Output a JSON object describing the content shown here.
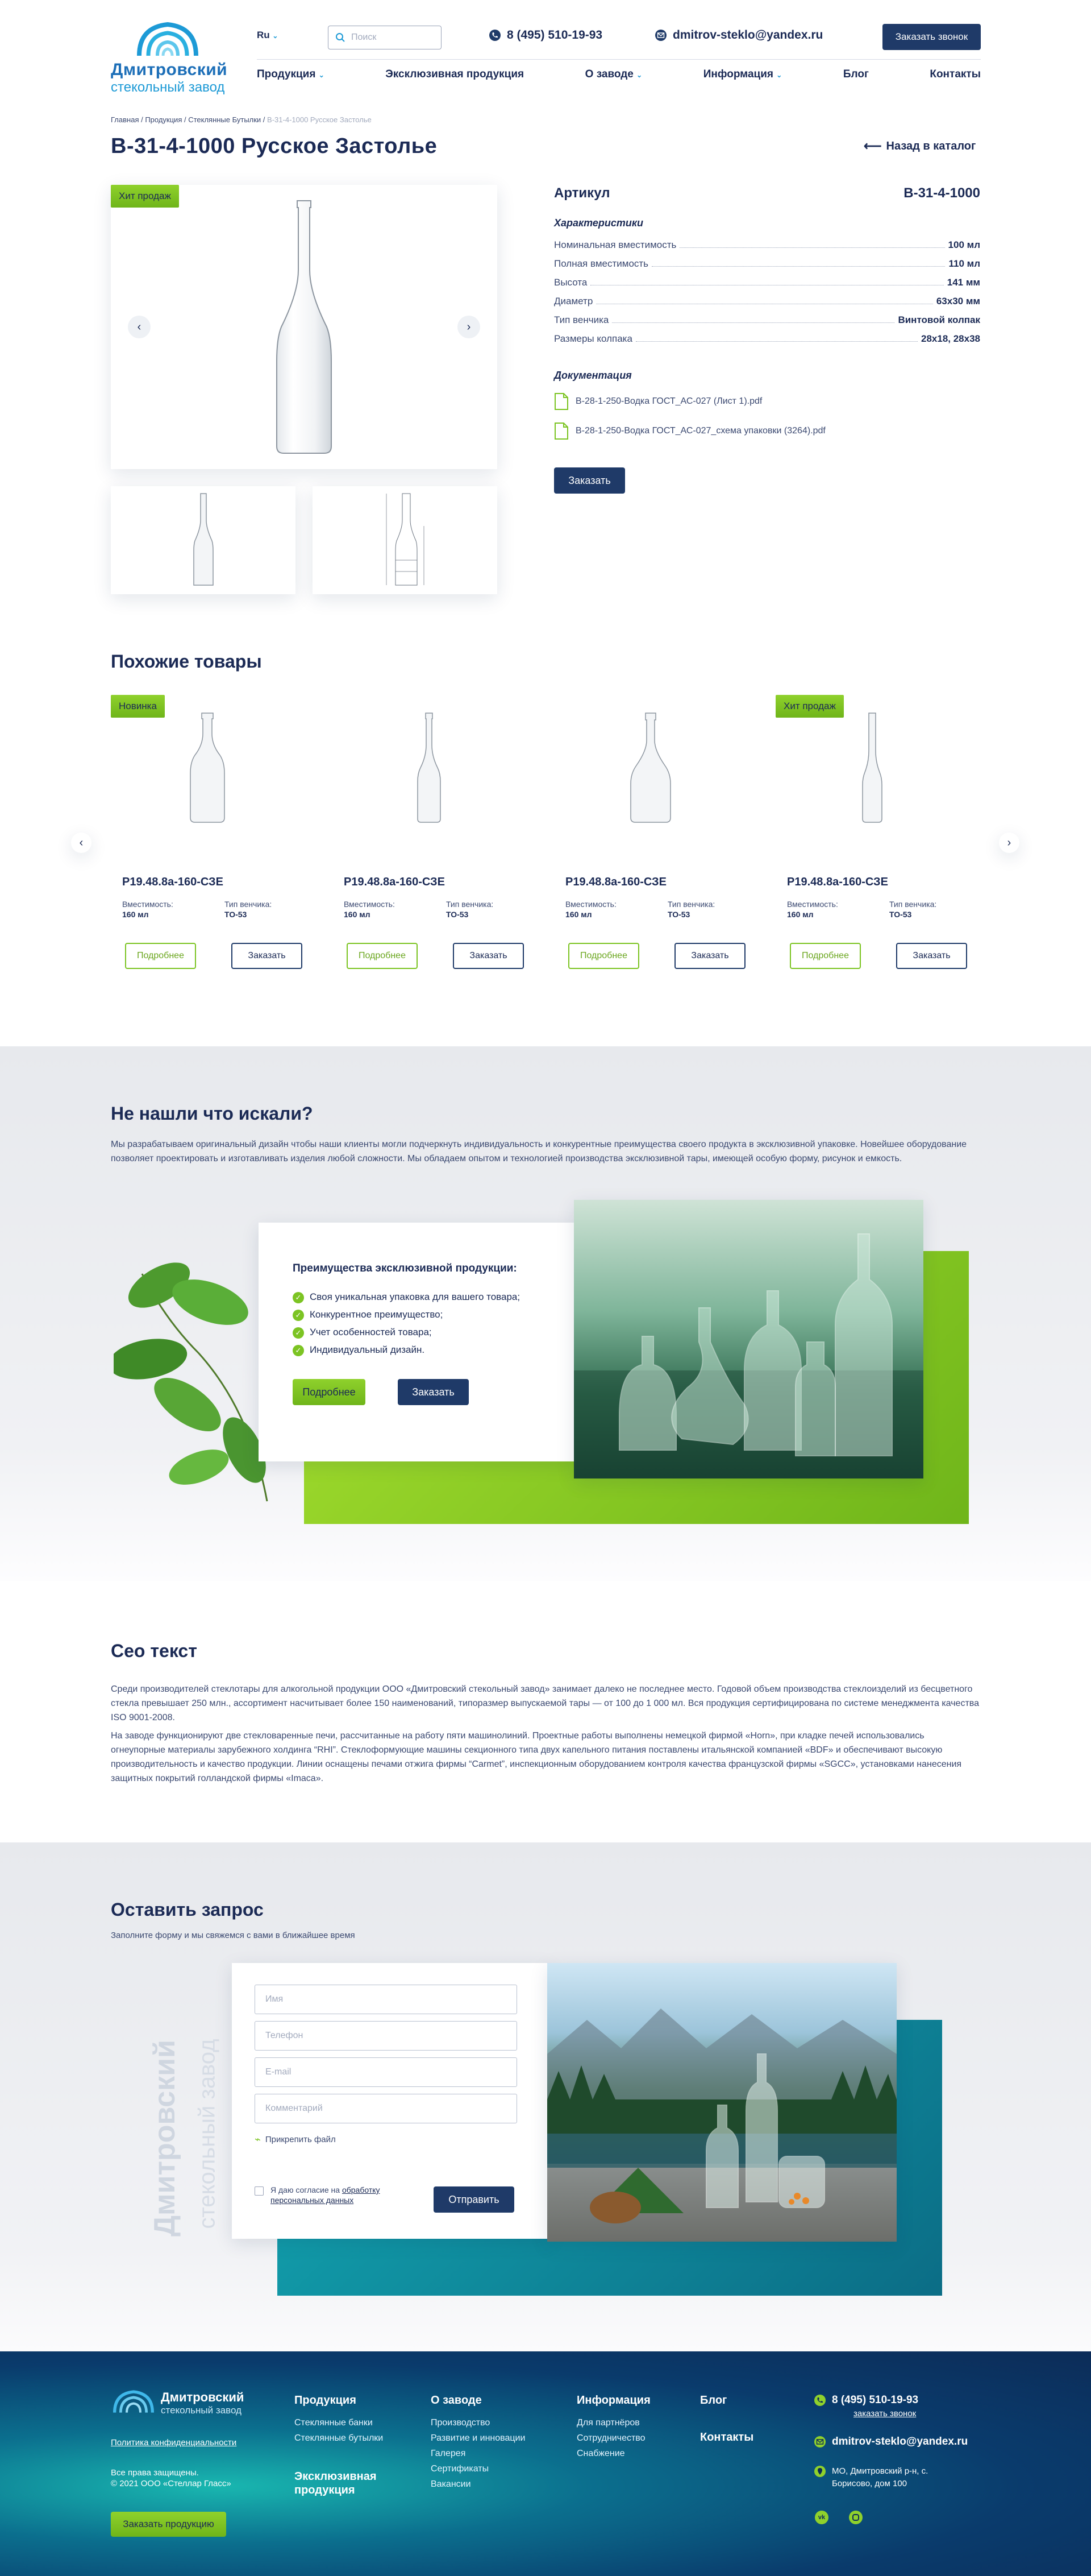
{
  "header": {
    "logo_top": "Дмитровский",
    "logo_bottom": "стекольный завод",
    "lang": "Ru",
    "search_placeholder": "Поиск",
    "phone": "8 (495) 510-19-93",
    "email": "dmitrov-steklo@yandex.ru",
    "callback_label": "Заказать звонок",
    "nav": [
      "Продукция",
      "Эксклюзивная продукция",
      "О заводе",
      "Информация",
      "Блог",
      "Контакты"
    ]
  },
  "breadcrumb": {
    "path": "Главная / Продукция / Стеклянные Бутылки /",
    "current": "В-31-4-1000 Русское Застолье"
  },
  "product": {
    "title": "В-31-4-1000 Русское Застолье",
    "back_label": "Назад в каталог",
    "badge": "Хит продаж",
    "article_label": "Артикул",
    "article_value": "В-31-4-1000",
    "specs_title": "Характеристики",
    "specs": [
      {
        "k": "Номинальная вместимость",
        "v": "100 мл"
      },
      {
        "k": "Полная вместимость",
        "v": "110 мл"
      },
      {
        "k": "Высота",
        "v": "141 мм"
      },
      {
        "k": "Диаметр",
        "v": "63х30 мм"
      },
      {
        "k": "Тип венчика",
        "v": "Винтовой колпак"
      },
      {
        "k": "Размеры колпака",
        "v": "28х18, 28х38"
      }
    ],
    "docs_title": "Документация",
    "docs": [
      "В-28-1-250-Водка ГОСТ_АС-027 (Лист 1).pdf",
      "В-28-1-250-Водка ГОСТ_АС-027_схема упаковки (3264).pdf"
    ],
    "order_label": "Заказать"
  },
  "similar": {
    "title": "Похожие товары",
    "items": [
      {
        "badge": "Новинка",
        "name": "Р19.48.8а-160-СЗЕ",
        "cap_label": "Вместимость:",
        "cap": "160 мл",
        "neck_label": "Тип венчика:",
        "neck": "ТО-53",
        "more": "Подробнее",
        "order": "Заказать"
      },
      {
        "badge": "",
        "name": "Р19.48.8а-160-СЗЕ",
        "cap_label": "Вместимость:",
        "cap": "160 мл",
        "neck_label": "Тип венчика:",
        "neck": "ТО-53",
        "more": "Подробнее",
        "order": "Заказать"
      },
      {
        "badge": "",
        "name": "Р19.48.8а-160-СЗЕ",
        "cap_label": "Вместимость:",
        "cap": "160 мл",
        "neck_label": "Тип венчика:",
        "neck": "ТО-53",
        "more": "Подробнее",
        "order": "Заказать"
      },
      {
        "badge": "Хит продаж",
        "name": "Р19.48.8а-160-СЗЕ",
        "cap_label": "Вместимость:",
        "cap": "160 мл",
        "neck_label": "Тип венчика:",
        "neck": "ТО-53",
        "more": "Подробнее",
        "order": "Заказать"
      }
    ]
  },
  "exclusive": {
    "title": "Не нашли что искали?",
    "text": "Мы разрабатываем оригинальный дизайн чтобы наши клиенты могли подчеркнуть индивидуальность и конкурентные преимущества своего продукта в эксклюзивной упаковке. Новейшее оборудование позволяет проектировать и изготавливать изделия любой сложности. Мы обладаем опытом и технологией производства эксклюзивной тары, имеющей особую форму, рисунок и емкость.",
    "card_title": "Преимущества эксклюзивной продукции:",
    "points": [
      "Своя уникальная упаковка для вашего товара;",
      "Конкурентное преимущество;",
      "Учет особенностей товара;",
      "Индивидуальный дизайн."
    ],
    "more_label": "Подробнее",
    "order_label": "Заказать"
  },
  "seo": {
    "title": "Сео текст",
    "p1": "Среди производителей стеклотары для алкогольной продукции ООО «Дмитровский стекольный завод» занимает далеко не последнее место. Годовой объем производства стеклоизделий из бесцветного стекла превышает 250 млн., ассортимент насчитывает более 150 наименований, типоразмер выпускаемой тары — от 100 до 1 000 мл. Вся продукция сертифицирована по системе менеджмента качества ISO 9001-2008.",
    "p2": "На заводе функционируют две стекловаренные печи, рассчитанные на работу пяти машинолиний. Проектные работы выполнены немецкой фирмой «Horn», при кладке печей использовались огнеупорные материалы зарубежного холдинга “RHI”. Стеклоформующие машины секционного типа двух капельного питания поставлены итальянской компанией «BDF» и обеспечивают высокую производительность и качество продукции. Линии оснащены печами отжига фирмы “Carmet”, инспекционным оборудованием контроля качества французской фирмы «SGCC», установками нанесения защитных покрытий голландской фирмы «Imaca»."
  },
  "request": {
    "title": "Оставить запрос",
    "subtitle": "Заполните форму и мы свяжемся с вами в ближайшее время",
    "watermark_top": "Дмитровский",
    "watermark_bottom": "стекольный завод",
    "name_ph": "Имя",
    "phone_ph": "Телефон",
    "email_ph": "E-mail",
    "comment_ph": "Комментарий",
    "attach": "Прикрепить файл",
    "consent_prefix": "Я даю согласие на",
    "consent_link": "обработку персональных данных",
    "submit": "Отправить"
  },
  "footer": {
    "logo_top": "Дмитровский",
    "logo_bottom": "стекольный завод",
    "privacy": "Политика конфиденциальности",
    "rights": "Все права защищены.",
    "copy": "© 2021 ООО «Стеллар Гласс»",
    "order_label": "Заказать продукцию",
    "col1_title": "Продукция",
    "col1": [
      "Стеклянные банки",
      "Стеклянные бутылки"
    ],
    "col1b_title": "Эксклюзивная продукция",
    "col2_title": "О заводе",
    "col2": [
      "Производство",
      "Развитие и инновации",
      "Галерея",
      "Сертификаты",
      "Вакансии"
    ],
    "col3_title": "Информация",
    "col3": [
      "Для партнёров",
      "Сотрудничество",
      "Снабжение"
    ],
    "col4_title": "Блог",
    "col4b_title": "Контакты",
    "phone": "8 (495) 510-19-93",
    "callback": "заказать звонок",
    "email": "dmitrov-steklo@yandex.ru",
    "address": "МО, Дмитровский р-н, с. Борисово, дом 100"
  },
  "colors": {
    "navy": "#1f3a68",
    "green": "#7cc423",
    "teal": "#0f8a9a"
  }
}
